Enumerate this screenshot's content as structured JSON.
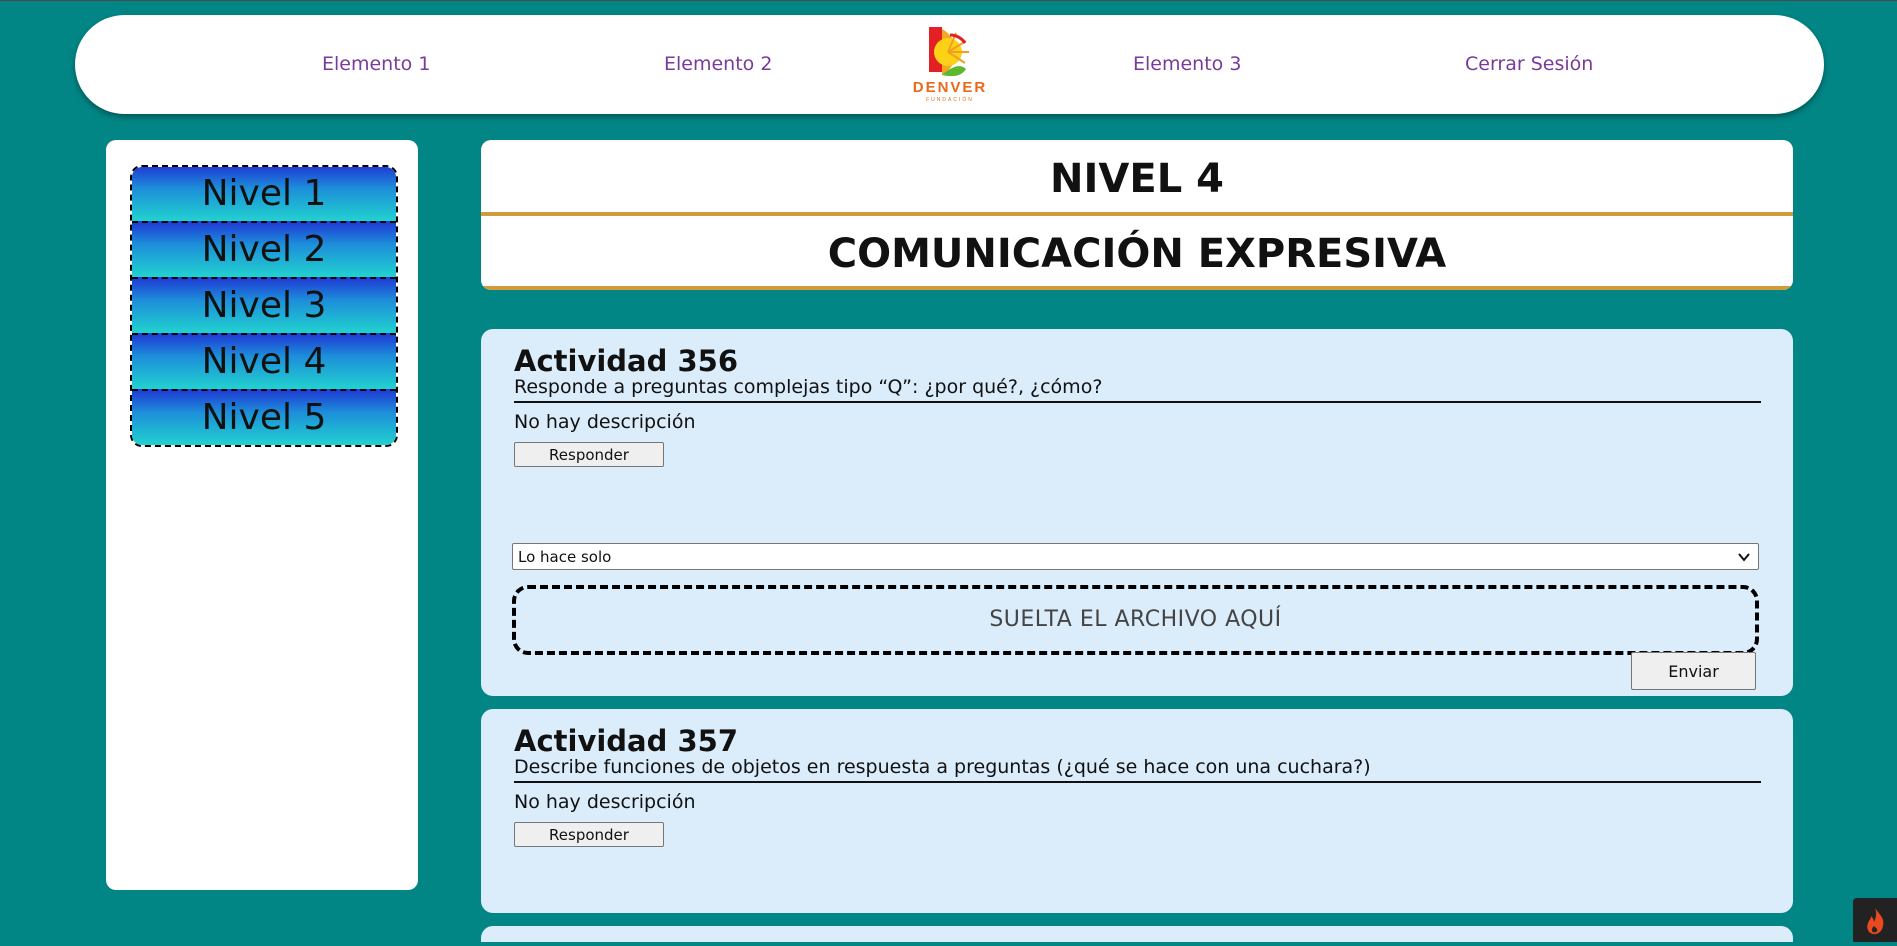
{
  "navbar": {
    "items": [
      {
        "label": "Elemento 1"
      },
      {
        "label": "Elemento 2"
      },
      {
        "label": "Elemento 3"
      },
      {
        "label": "Cerrar Sesión"
      }
    ],
    "logo_text": "DENVER",
    "logo_subtext": "FUNDACIÓN"
  },
  "sidebar": {
    "levels": [
      {
        "label": "Nivel 1"
      },
      {
        "label": "Nivel 2"
      },
      {
        "label": "Nivel 3"
      },
      {
        "label": "Nivel 4"
      },
      {
        "label": "Nivel 5"
      }
    ]
  },
  "header": {
    "level_title": "NIVEL 4",
    "subject_title": "COMUNICACIÓN EXPRESIVA"
  },
  "activities": [
    {
      "title": "Actividad 356",
      "subtitle": "Responde a preguntas complejas tipo “Q”: ¿por qué?, ¿cómo?",
      "description": "No hay descripción",
      "respond_label": "Responder",
      "select_value": "Lo hace solo",
      "dropzone_label": "SUELTA EL ARCHIVO AQUÍ",
      "send_label": "Enviar"
    },
    {
      "title": "Actividad 357",
      "subtitle": "Describe funciones de objetos en respuesta a preguntas (¿qué se hace con una cuchara?)",
      "description": "No hay descripción",
      "respond_label": "Responder"
    }
  ],
  "colors": {
    "background": "#028585",
    "nav_link": "#7a3a9a",
    "card": "#dbecfb",
    "accent_line": "#d19a3a"
  }
}
